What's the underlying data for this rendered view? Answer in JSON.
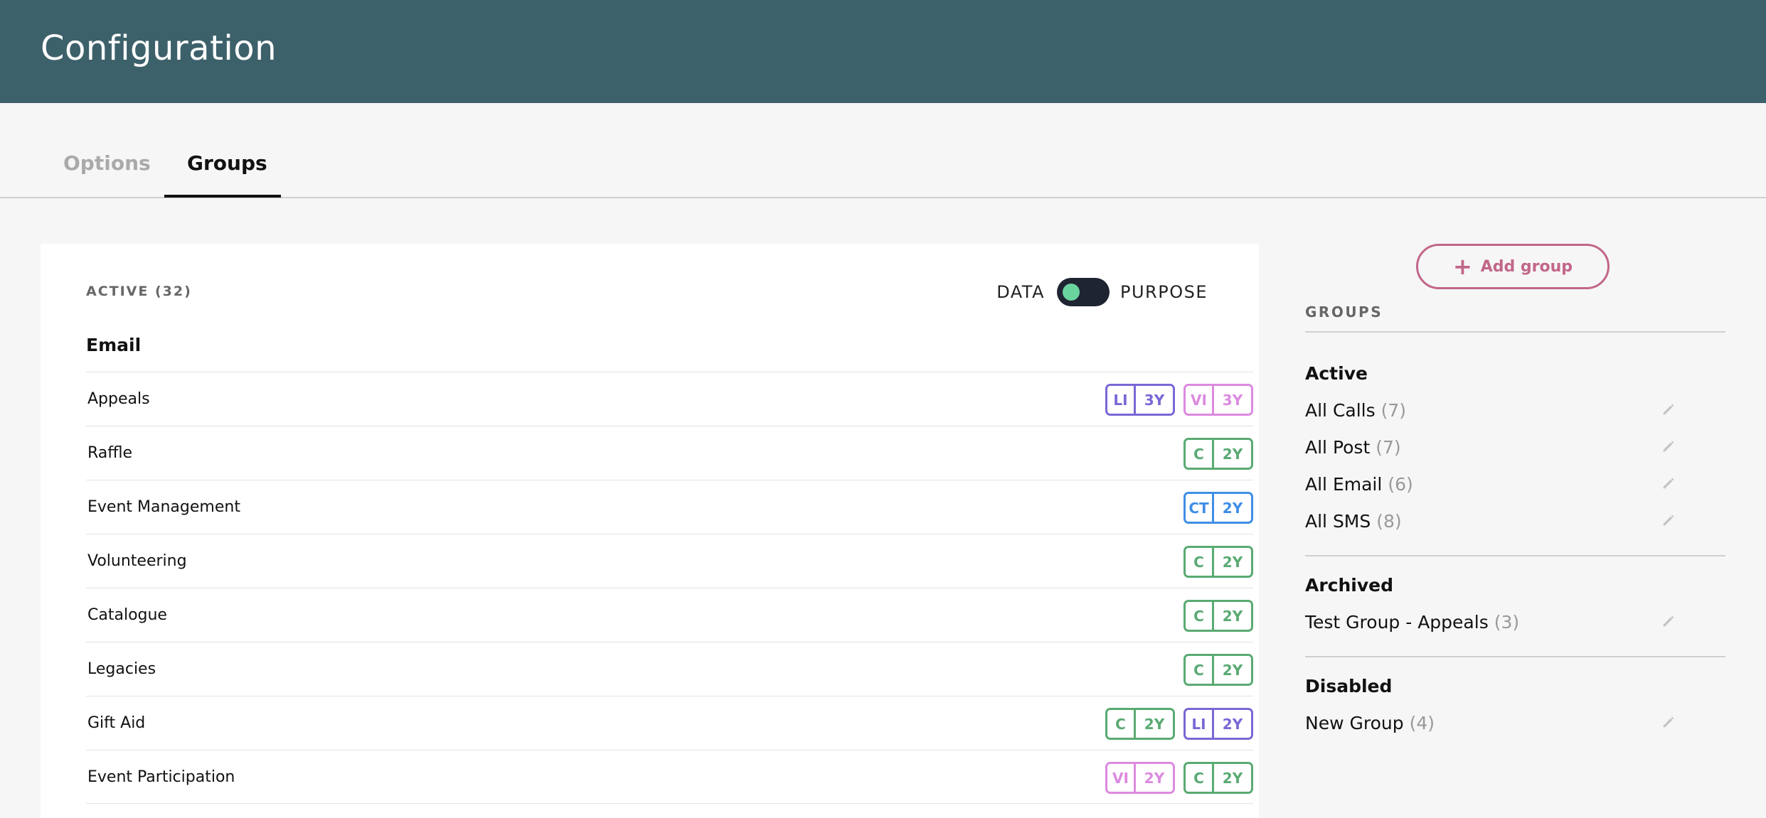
{
  "header": {
    "title": "Configuration"
  },
  "tabs": {
    "options": "Options",
    "groups": "Groups"
  },
  "main": {
    "active_label": "ACTIVE (32)",
    "toggle": {
      "left": "DATA",
      "right": "PURPOSE"
    },
    "section": "Email",
    "rows": [
      {
        "name": "Appeals",
        "badges": [
          {
            "a": "LI",
            "b": "3Y",
            "color": "#7b67d6"
          },
          {
            "a": "VI",
            "b": "3Y",
            "color": "#dc8ae0"
          }
        ]
      },
      {
        "name": "Raffle",
        "badges": [
          {
            "a": "C",
            "b": "2Y",
            "color": "#5aaa72"
          }
        ]
      },
      {
        "name": "Event Management",
        "badges": [
          {
            "a": "CT",
            "b": "2Y",
            "color": "#3f8ee6"
          }
        ]
      },
      {
        "name": "Volunteering",
        "badges": [
          {
            "a": "C",
            "b": "2Y",
            "color": "#5aaa72"
          }
        ]
      },
      {
        "name": "Catalogue",
        "badges": [
          {
            "a": "C",
            "b": "2Y",
            "color": "#5aaa72"
          }
        ]
      },
      {
        "name": "Legacies",
        "badges": [
          {
            "a": "C",
            "b": "2Y",
            "color": "#5aaa72"
          }
        ]
      },
      {
        "name": "Gift Aid",
        "badges": [
          {
            "a": "C",
            "b": "2Y",
            "color": "#5aaa72"
          },
          {
            "a": "LI",
            "b": "2Y",
            "color": "#7b67d6"
          }
        ]
      },
      {
        "name": "Event Participation",
        "badges": [
          {
            "a": "VI",
            "b": "2Y",
            "color": "#dc8ae0"
          },
          {
            "a": "C",
            "b": "2Y",
            "color": "#5aaa72"
          }
        ]
      }
    ]
  },
  "sidebar": {
    "add_group": "Add group",
    "heading": "GROUPS",
    "sections": {
      "active": {
        "title": "Active",
        "items": [
          {
            "name": "All Calls",
            "count": "(7)"
          },
          {
            "name": "All Post",
            "count": "(7)"
          },
          {
            "name": "All Email",
            "count": "(6)"
          },
          {
            "name": "All SMS",
            "count": "(8)"
          }
        ]
      },
      "archived": {
        "title": "Archived",
        "items": [
          {
            "name": "Test Group - Appeals",
            "count": "(3)"
          }
        ]
      },
      "disabled": {
        "title": "Disabled",
        "items": [
          {
            "name": "New Group",
            "count": "(4)"
          }
        ]
      }
    }
  },
  "colors": {
    "header_bg": "#3d616b",
    "accent": "#c2668a",
    "toggle_knob": "#6ad49e"
  }
}
